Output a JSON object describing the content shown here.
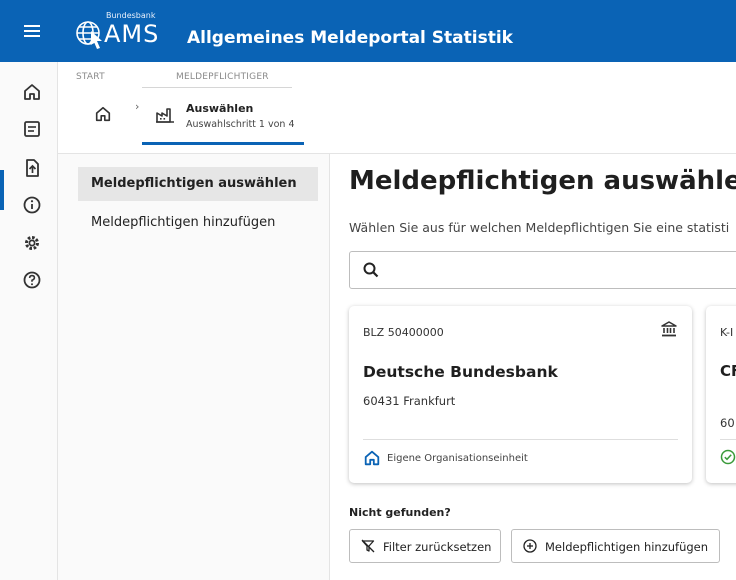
{
  "header": {
    "logo_small_text": "Bundesbank",
    "logo_text": "AMS",
    "title": "Allgemeines Meldeportal Statistik"
  },
  "rail": {
    "items": [
      "home-icon",
      "list-icon",
      "upload-icon",
      "info-icon",
      "settings-icon",
      "help-icon"
    ],
    "active": "list-icon"
  },
  "breadcrumb": {
    "start": "START",
    "meldepflichtiger": "MELDEPFLICHTIGER",
    "step_title": "Auswählen",
    "step_subtitle": "Auswahlschritt 1 von 4"
  },
  "sidenav": {
    "items": [
      {
        "label": "Meldepflichtigen auswählen",
        "active": true
      },
      {
        "label": "Meldepflichtigen hinzufügen",
        "active": false
      }
    ]
  },
  "main": {
    "title": "Meldepflichtigen auswählen",
    "description": "Wählen Sie aus für welchen Meldepflichtigen Sie eine statisti",
    "search": {
      "value": "",
      "placeholder": ""
    },
    "cards": [
      {
        "id_label": "BLZ 50400000",
        "name": "Deutsche Bundesbank",
        "city": "60431 Frankfurt",
        "footer": "Eigene Organisationseinheit",
        "type_icon": "bank-icon",
        "footer_icon": "home-icon"
      },
      {
        "id_label": "K-I",
        "name": "CF Re",
        "city": "60",
        "footer_icon": "check-circle-icon"
      }
    ],
    "not_found": "Nicht gefunden?",
    "buttons": {
      "reset_filter": "Filter zurücksetzen",
      "add": "Meldepflichtigen hinzufügen"
    }
  },
  "colors": {
    "primary": "#0a63b5",
    "nav_active_bg": "#e6e6e6",
    "success": "#3a9a3a"
  }
}
